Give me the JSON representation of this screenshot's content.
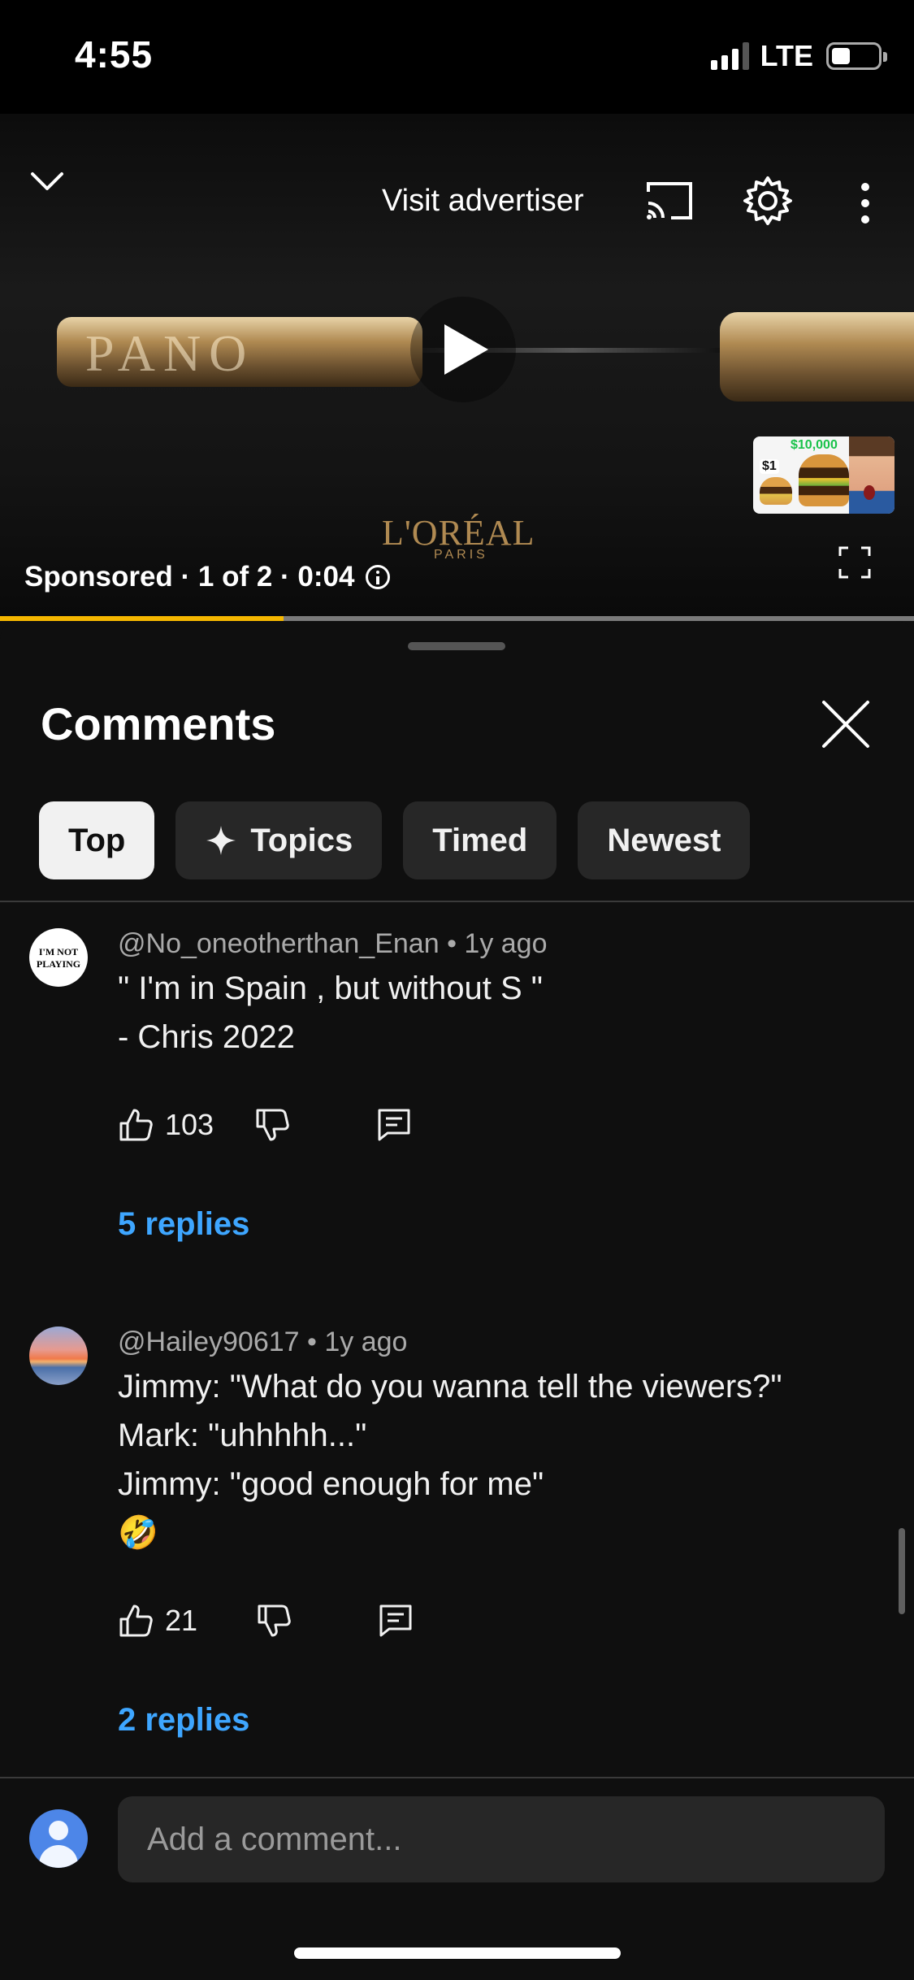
{
  "status_bar": {
    "time": "4:55",
    "network": "LTE",
    "signal_bars": 3
  },
  "player": {
    "visit_advertiser": "Visit advertiser",
    "ad_brand": "L'ORÉAL",
    "ad_brand_sub": "PARIS",
    "product_text": "PANO",
    "sponsored_label": "Sponsored · 1 of 2 · 0:04",
    "progress_fraction": 0.31,
    "thumbnail": {
      "badge_top": "$10,000",
      "badge_left": "$1"
    },
    "colors": {
      "progress": "#f5b700",
      "track": "#7a7a7a"
    }
  },
  "comments_panel": {
    "title": "Comments",
    "chips": [
      {
        "label": "Top",
        "active": true
      },
      {
        "label": "Topics",
        "icon": "sparkle-icon"
      },
      {
        "label": "Timed"
      },
      {
        "label": "Newest"
      }
    ],
    "comments": [
      {
        "author": "@No_oneotherthan_Enan",
        "time": "1y ago",
        "avatar_text": "I'M NOT PLAYING",
        "text": "\" I'm in Spain , but without S \"\n- Chris 2022",
        "likes": "103",
        "replies": "5 replies"
      },
      {
        "author": "@Hailey90617",
        "time": "1y ago",
        "text": "Jimmy: \"What do you wanna tell the viewers?\"\nMark: \"uhhhhh...\"\nJimmy: \"good enough for me\"\n🤣",
        "likes": "21",
        "replies": "2 replies"
      }
    ],
    "composer_placeholder": "Add a comment...",
    "accent_color": "#3ea6ff"
  }
}
